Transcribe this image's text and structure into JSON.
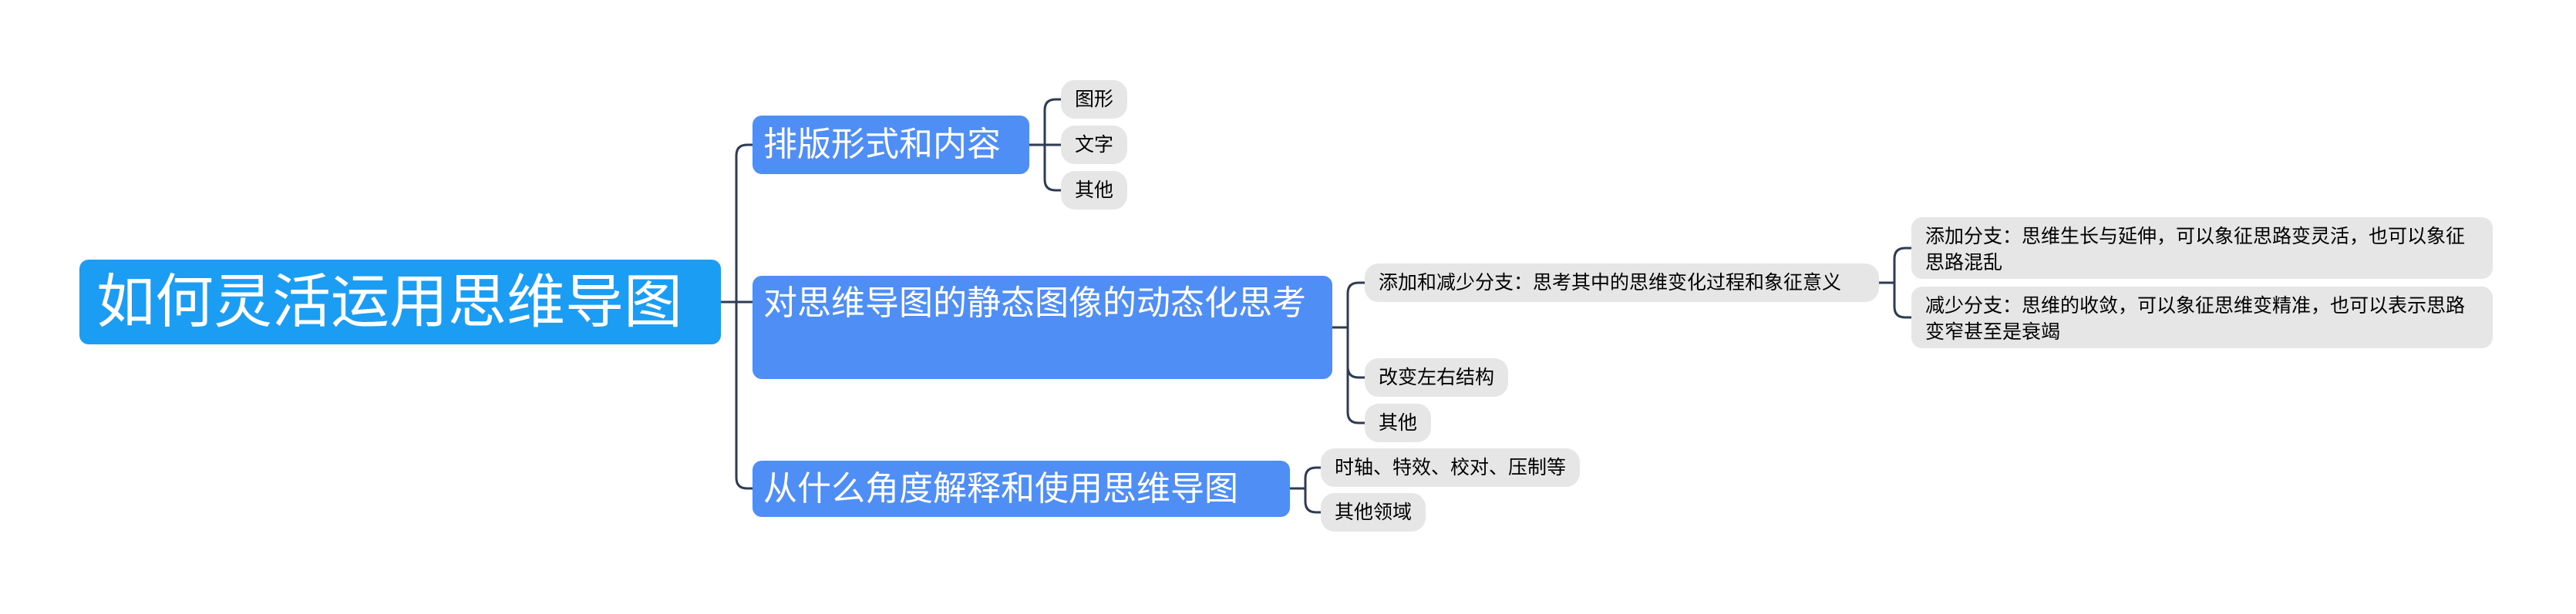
{
  "mindmap": {
    "root": "如何灵活运用思维导图",
    "branches": [
      {
        "label": "排版形式和内容",
        "children": [
          {
            "label": "图形"
          },
          {
            "label": "文字"
          },
          {
            "label": "其他"
          }
        ]
      },
      {
        "label": "对思维导图的静态图像的动态化思考",
        "children": [
          {
            "label": "添加和减少分支：思考其中的思维变化过程和象征意义",
            "children": [
              {
                "label": "添加分支：思维生长与延伸，可以象征思路变灵活，也可以象征思路混乱"
              },
              {
                "label": "减少分支：思维的收敛，可以象征思维变精准，也可以表示思路变窄甚至是衰竭"
              }
            ]
          },
          {
            "label": "改变左右结构"
          },
          {
            "label": "其他"
          }
        ]
      },
      {
        "label": "从什么角度解释和使用思维导图",
        "children": [
          {
            "label": "时轴、特效、校对、压制等"
          },
          {
            "label": "其他领域"
          }
        ]
      }
    ]
  },
  "colors": {
    "root_bg": "#1a9df2",
    "branch_bg": "#4f8ef5",
    "leaf_bg": "#e6e6e6",
    "connector": "#2f3b52"
  }
}
